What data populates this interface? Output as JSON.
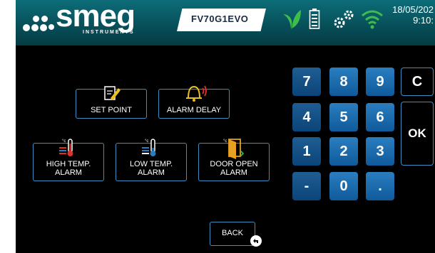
{
  "header": {
    "logo_word": "smeg",
    "logo_sub": "INSTRUMENTS",
    "model": "FV70G1EVO",
    "date": "18/05/202",
    "time": "9:10:"
  },
  "menu": {
    "set_point": "SET POINT",
    "alarm_delay": "ALARM DELAY",
    "high_temp_alarm_1": "HIGH TEMP.",
    "high_temp_alarm_2": "ALARM",
    "low_temp_alarm_1": "LOW TEMP.",
    "low_temp_alarm_2": "ALARM",
    "door_open_alarm_1": "DOOR OPEN",
    "door_open_alarm_2": "ALARM"
  },
  "keypad": {
    "k7": "7",
    "k8": "8",
    "k9": "9",
    "k4": "4",
    "k5": "5",
    "k6": "6",
    "k1": "1",
    "k2": "2",
    "k3": "3",
    "minus": "-",
    "k0": "0",
    "dot": ".",
    "clear": "C",
    "ok": "OK"
  },
  "back_label": "BACK",
  "icons": {
    "leaf": "leaf-icon",
    "battery": "battery-icon",
    "settings": "gears-icon",
    "wifi": "wifi-icon"
  },
  "colors": {
    "header": "#07505a",
    "key": "#1a6aaa",
    "border": "#3b8fc4",
    "accent_green": "#3dbd4a"
  }
}
